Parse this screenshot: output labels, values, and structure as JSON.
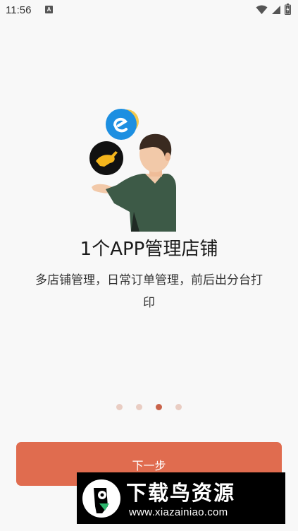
{
  "status_bar": {
    "time": "11:56",
    "notification_icon": "a-letter-icon",
    "icons": [
      "wifi-icon",
      "signal-icon",
      "battery-icon"
    ]
  },
  "onboarding": {
    "headline": "1个APP管理店铺",
    "subtitle": "多店铺管理，日常订单管理，前后出分台打印",
    "page_indicator": {
      "total": 4,
      "active_index": 2
    },
    "next_button_label": "下一步"
  },
  "watermark": {
    "title": "下载鸟资源",
    "url": "www.xiazainiao.com"
  },
  "colors": {
    "accent": "#e06c4f",
    "dot_inactive": "#e9cdc3",
    "dot_active": "#c9634a",
    "jacket": "#3d5a47",
    "eleme_blue": "#1d8fe1"
  }
}
